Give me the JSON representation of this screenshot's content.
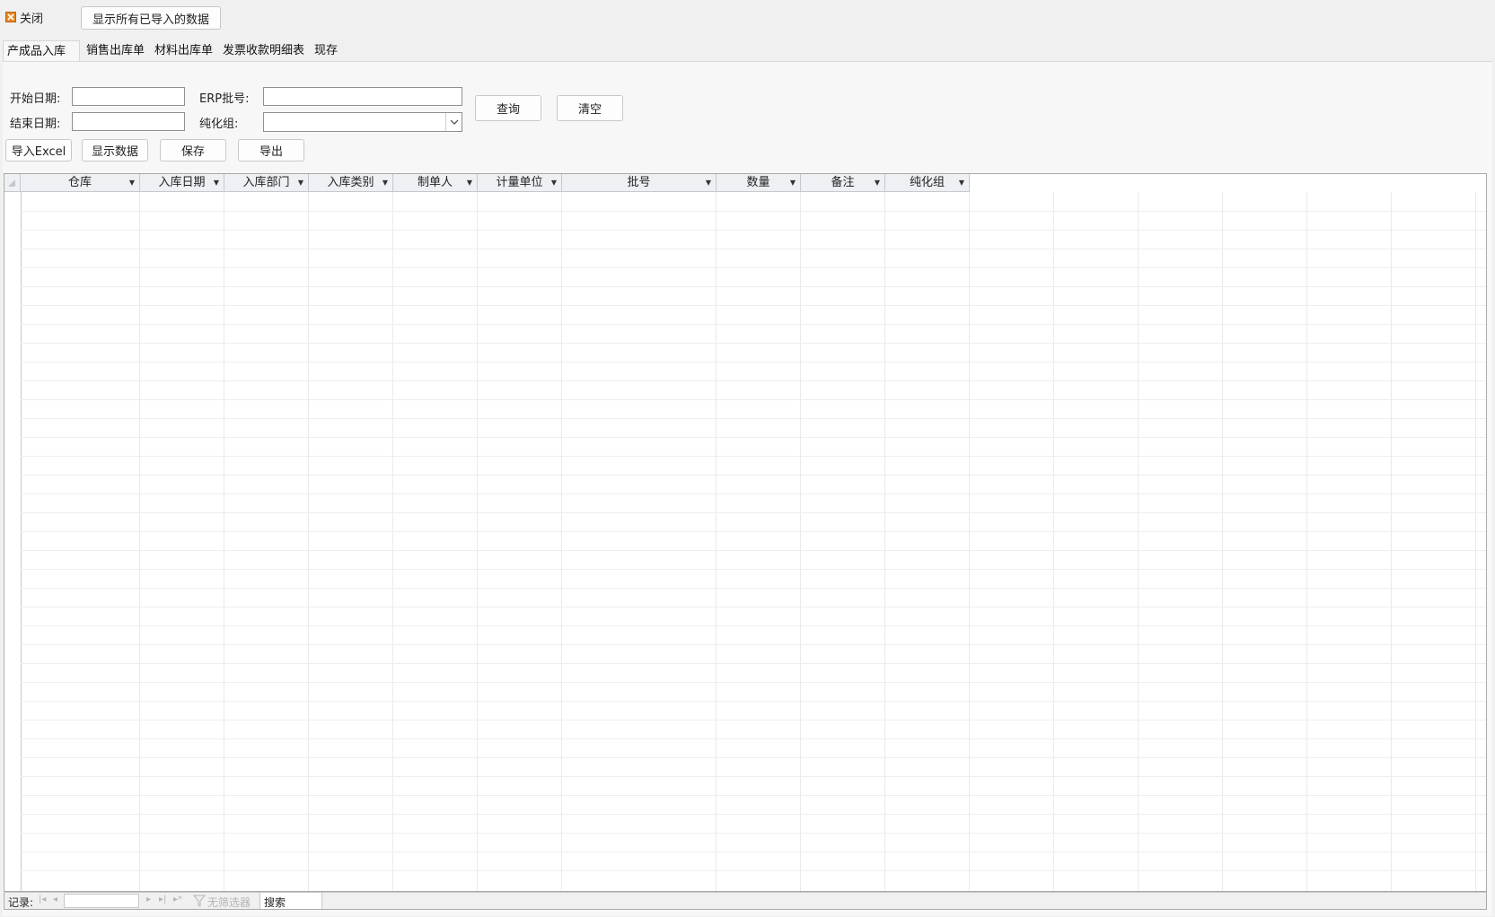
{
  "topbar": {
    "close_label": "关闭",
    "show_all_label": "显示所有已导入的数据"
  },
  "tabs": [
    "产成品入库单",
    "销售出库单",
    "材料出库单",
    "发票收款明细表",
    "现存量"
  ],
  "form": {
    "start_date_label": "开始日期:",
    "end_date_label": "结束日期:",
    "erp_batch_label": "ERP批号:",
    "purify_group_label": "纯化组:",
    "start_date_value": "",
    "end_date_value": "",
    "erp_batch_value": "",
    "purify_group_value": "",
    "query_label": "查询",
    "clear_label": "清空"
  },
  "toolbar": {
    "import_excel_label": "导入Excel",
    "show_data_label": "显示数据",
    "save_label": "保存",
    "export_label": "导出"
  },
  "table": {
    "columns": [
      "仓库",
      "入库日期",
      "入库部门",
      "入库类别",
      "制单人",
      "计量单位",
      "批号",
      "数量",
      "备注",
      "纯化组"
    ],
    "rows": []
  },
  "statusbar": {
    "record_label": "记录:",
    "no_filter_label": "无筛选器",
    "search_label": "搜索"
  },
  "colors": {
    "background": "#f0f0f0",
    "panel": "#f7f7f7",
    "header": "#eef0f4",
    "close_icon": "#e8881f"
  },
  "icons": {
    "close": "close-icon",
    "dropdown": "chevron-down-icon",
    "filter": "filter-icon"
  }
}
